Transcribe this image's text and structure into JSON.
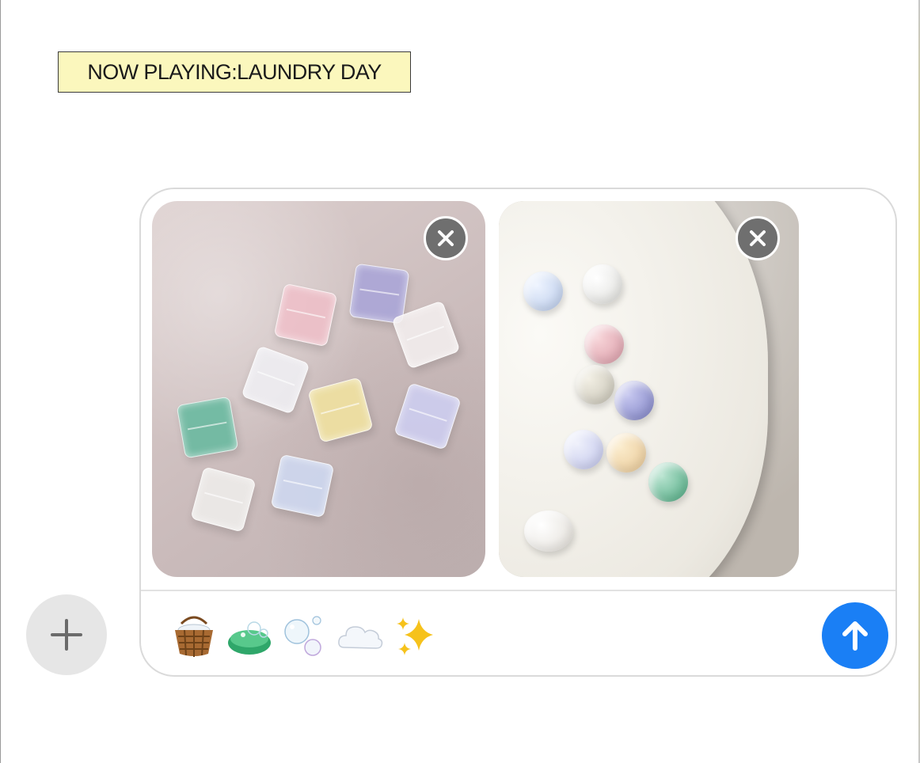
{
  "banner": {
    "text": "NOW PLAYING:LAUNDRY DAY"
  },
  "composer": {
    "attachments": [
      {
        "name": "acrylic cubes photo",
        "remove_icon": "close-icon"
      },
      {
        "name": "glass beads on plate photo",
        "remove_icon": "close-icon"
      }
    ],
    "emoji": [
      "basket-emoji",
      "soap-emoji",
      "bubbles-emoji",
      "cloud-emoji",
      "sparkles-emoji"
    ],
    "send_icon": "arrow-up-icon",
    "send_color": "#1a7ff5"
  },
  "add_button": {
    "icon": "plus-icon"
  }
}
